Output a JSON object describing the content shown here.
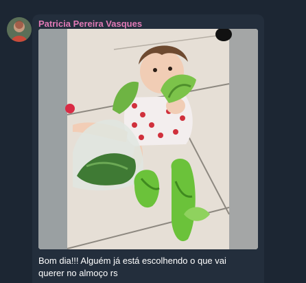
{
  "message": {
    "sender_name": "Patricia Pereira Vasques",
    "caption_line1": "Bom dia!!! Alguém já está escolhendo o que vai",
    "caption_line2": "querer no almoço rs"
  },
  "colors": {
    "background": "#1c2633",
    "bubble": "#232e3c",
    "sender_name": "#e07ab6",
    "caption_text": "#ffffff"
  }
}
